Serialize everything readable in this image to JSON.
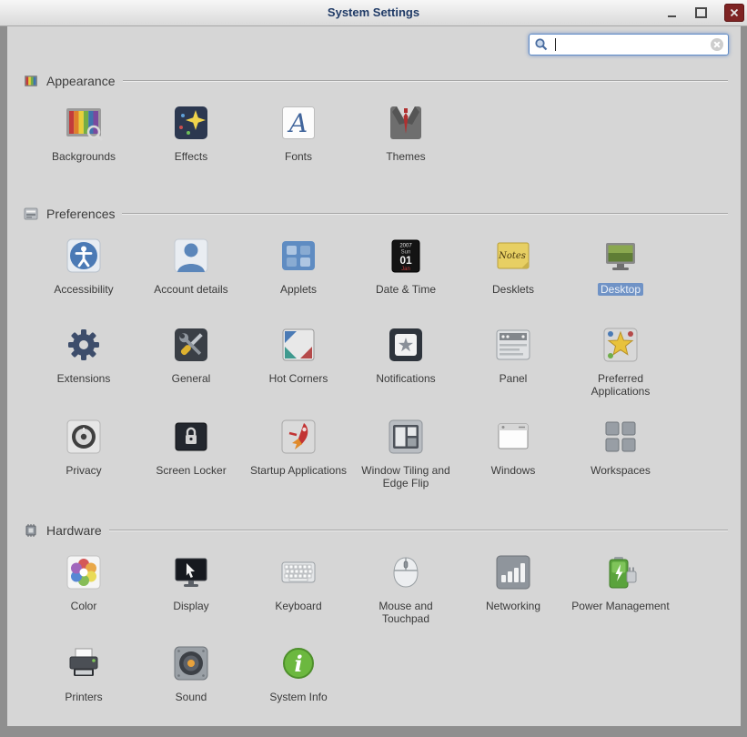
{
  "window": {
    "title": "System Settings",
    "controls": [
      "minimize",
      "maximize",
      "close"
    ]
  },
  "search": {
    "value": "",
    "placeholder": ""
  },
  "colors": {
    "accent": "#7093c6",
    "titlebar_text": "#1f3a66",
    "content_bg": "#d6d6d6",
    "desktop_bg": "#8f8f8f",
    "close_button": "#7e2323",
    "search_focus_border": "#5f8bc7"
  },
  "icon_texts": {
    "fonts_letter": "A",
    "calendar_year": "2007",
    "calendar_weekday": "Sun",
    "calendar_month": "Jan",
    "calendar_day": "01",
    "desklets_word": "Notes",
    "info_letter": "i"
  },
  "sections": [
    {
      "title": "Appearance",
      "icon": "appearance-section-icon",
      "items": [
        {
          "label": "Backgrounds",
          "icon": "backgrounds-icon"
        },
        {
          "label": "Effects",
          "icon": "effects-icon"
        },
        {
          "label": "Fonts",
          "icon": "fonts-icon"
        },
        {
          "label": "Themes",
          "icon": "themes-icon"
        }
      ]
    },
    {
      "title": "Preferences",
      "icon": "preferences-section-icon",
      "items": [
        {
          "label": "Accessibility",
          "icon": "accessibility-icon"
        },
        {
          "label": "Account details",
          "icon": "account-details-icon"
        },
        {
          "label": "Applets",
          "icon": "applets-icon"
        },
        {
          "label": "Date & Time",
          "icon": "date-time-icon"
        },
        {
          "label": "Desklets",
          "icon": "desklets-icon"
        },
        {
          "label": "Desktop",
          "icon": "desktop-icon",
          "selected": true
        },
        {
          "label": "Extensions",
          "icon": "extensions-icon"
        },
        {
          "label": "General",
          "icon": "general-icon"
        },
        {
          "label": "Hot Corners",
          "icon": "hot-corners-icon"
        },
        {
          "label": "Notifications",
          "icon": "notifications-icon"
        },
        {
          "label": "Panel",
          "icon": "panel-icon"
        },
        {
          "label": "Preferred Applications",
          "icon": "preferred-applications-icon"
        },
        {
          "label": "Privacy",
          "icon": "privacy-icon"
        },
        {
          "label": "Screen Locker",
          "icon": "screen-locker-icon"
        },
        {
          "label": "Startup Applications",
          "icon": "startup-applications-icon"
        },
        {
          "label": "Window Tiling and Edge Flip",
          "icon": "window-tiling-icon"
        },
        {
          "label": "Windows",
          "icon": "windows-icon"
        },
        {
          "label": "Workspaces",
          "icon": "workspaces-icon"
        }
      ]
    },
    {
      "title": "Hardware",
      "icon": "hardware-section-icon",
      "items": [
        {
          "label": "Color",
          "icon": "color-icon"
        },
        {
          "label": "Display",
          "icon": "display-icon"
        },
        {
          "label": "Keyboard",
          "icon": "keyboard-icon"
        },
        {
          "label": "Mouse and Touchpad",
          "icon": "mouse-touchpad-icon"
        },
        {
          "label": "Networking",
          "icon": "networking-icon"
        },
        {
          "label": "Power Management",
          "icon": "power-management-icon"
        },
        {
          "label": "Printers",
          "icon": "printers-icon"
        },
        {
          "label": "Sound",
          "icon": "sound-icon"
        },
        {
          "label": "System Info",
          "icon": "system-info-icon"
        }
      ]
    }
  ]
}
